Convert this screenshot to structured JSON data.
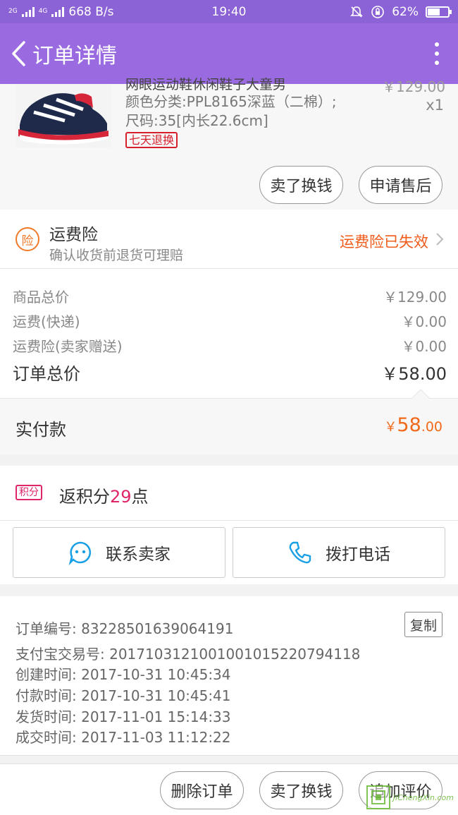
{
  "status_bar": {
    "network": "4G",
    "speed": "668 B/s",
    "time": "19:40",
    "battery": "62%",
    "battery_level": 0.62
  },
  "nav": {
    "title": "订单详情"
  },
  "product": {
    "title_partial": "网眼运动鞋休闲鞋子大童男",
    "sku_color": "颜色分类:PPL8165深蓝（二棉）;",
    "sku_size": "尺码:35[内长22.6cm]",
    "price": "￥129.00",
    "qty": "x1",
    "tag": "七天退换",
    "btn_sell": "卖了换钱",
    "btn_after_sale": "申请售后"
  },
  "insurance": {
    "icon_char": "险",
    "title": "运费险",
    "subtitle": "确认收货前退货可理赔",
    "status": "运费险已失效"
  },
  "summary": {
    "rows": [
      {
        "label": "商品总价",
        "value": "￥129.00"
      },
      {
        "label": "运费(快递)",
        "value": "￥0.00"
      },
      {
        "label": "运费险(卖家赠送)",
        "value": "￥0.00"
      }
    ],
    "total_label": "订单总价",
    "total_value": "￥58.00",
    "paid_label": "实付款",
    "paid_currency": "￥",
    "paid_int": "58",
    "paid_dec": ".00"
  },
  "points": {
    "tag": "积分",
    "prefix": "返积分",
    "num": "29",
    "suffix": "点"
  },
  "contact": {
    "seller": "联系卖家",
    "phone": "拨打电话"
  },
  "order_info": {
    "order_no": "订单编号: 832285016390641​91",
    "alipay_no": "支付宝交易号: 2017103121001001015220794118",
    "created": "创建时间: 2017-10-31 10:45:34",
    "paid": "付款时间: 2017-10-31 10:45:41",
    "shipped": "发货时间: 2017-11-01 15:14:33",
    "closed": "成交时间: 2017-11-03 11:12:22",
    "copy": "复制"
  },
  "bottom": {
    "delete": "删除订单",
    "sell": "卖了换钱",
    "review": "追加评价"
  },
  "watermark": {
    "text": "JiChengXin.com"
  }
}
